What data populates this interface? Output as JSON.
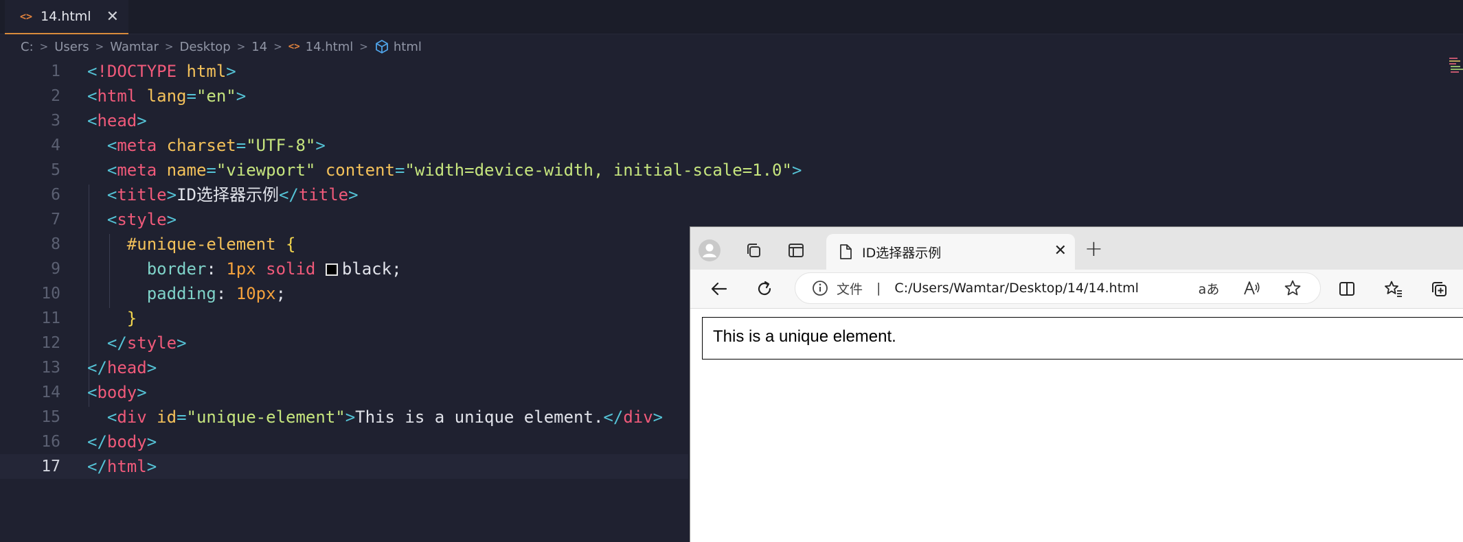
{
  "editor": {
    "tab": {
      "icon": "code-file-icon",
      "icon_glyph": "<>",
      "name": "14.html",
      "close": "✕"
    },
    "breadcrumb": [
      "C:",
      "Users",
      "Wamtar",
      "Desktop",
      "14",
      "14.html",
      "html"
    ],
    "breadcrumb_sep": ">",
    "current_line": 17,
    "lines": [
      {
        "n": "1",
        "parts": [
          [
            "t-punct",
            "<"
          ],
          [
            "t-tag",
            "!DOCTYPE"
          ],
          [
            "t-plain",
            " "
          ],
          [
            "t-attr",
            "html"
          ],
          [
            "t-punct",
            ">"
          ]
        ]
      },
      {
        "n": "2",
        "parts": [
          [
            "t-punct",
            "<"
          ],
          [
            "t-tag",
            "html"
          ],
          [
            "t-plain",
            " "
          ],
          [
            "t-attr",
            "lang"
          ],
          [
            "t-punct",
            "="
          ],
          [
            "t-str",
            "\"en\""
          ],
          [
            "t-punct",
            ">"
          ]
        ]
      },
      {
        "n": "3",
        "parts": [
          [
            "t-punct",
            "<"
          ],
          [
            "t-tag",
            "head"
          ],
          [
            "t-punct",
            ">"
          ]
        ]
      },
      {
        "n": "4",
        "parts": [
          [
            "t-plain",
            "  "
          ],
          [
            "t-punct",
            "<"
          ],
          [
            "t-tag",
            "meta"
          ],
          [
            "t-plain",
            " "
          ],
          [
            "t-attr",
            "charset"
          ],
          [
            "t-punct",
            "="
          ],
          [
            "t-str",
            "\"UTF-8\""
          ],
          [
            "t-punct",
            ">"
          ]
        ]
      },
      {
        "n": "5",
        "parts": [
          [
            "t-plain",
            "  "
          ],
          [
            "t-punct",
            "<"
          ],
          [
            "t-tag",
            "meta"
          ],
          [
            "t-plain",
            " "
          ],
          [
            "t-attr",
            "name"
          ],
          [
            "t-punct",
            "="
          ],
          [
            "t-str",
            "\"viewport\""
          ],
          [
            "t-plain",
            " "
          ],
          [
            "t-attr",
            "content"
          ],
          [
            "t-punct",
            "="
          ],
          [
            "t-str",
            "\"width=device-width, initial-scale=1.0\""
          ],
          [
            "t-punct",
            ">"
          ]
        ]
      },
      {
        "n": "6",
        "parts": [
          [
            "t-plain",
            "  "
          ],
          [
            "t-punct",
            "<"
          ],
          [
            "t-tag",
            "title"
          ],
          [
            "t-punct",
            ">"
          ],
          [
            "t-plain",
            "ID选择器示例"
          ],
          [
            "t-punct",
            "</"
          ],
          [
            "t-tag",
            "title"
          ],
          [
            "t-punct",
            ">"
          ]
        ]
      },
      {
        "n": "7",
        "parts": [
          [
            "t-plain",
            "  "
          ],
          [
            "t-punct",
            "<"
          ],
          [
            "t-tag",
            "style"
          ],
          [
            "t-punct",
            ">"
          ]
        ]
      },
      {
        "n": "8",
        "parts": [
          [
            "t-plain",
            "    "
          ],
          [
            "t-sel",
            "#unique-element"
          ],
          [
            "t-plain",
            " "
          ],
          [
            "t-brace",
            "{"
          ]
        ]
      },
      {
        "n": "9",
        "parts": [
          [
            "t-plain",
            "      "
          ],
          [
            "t-prop",
            "border"
          ],
          [
            "t-plain",
            ": "
          ],
          [
            "t-num",
            "1px"
          ],
          [
            "t-plain",
            " "
          ],
          [
            "t-kw",
            "solid"
          ],
          [
            "t-plain",
            " "
          ],
          [
            "swatch",
            ""
          ],
          [
            "t-plain",
            "black;"
          ]
        ]
      },
      {
        "n": "10",
        "parts": [
          [
            "t-plain",
            "      "
          ],
          [
            "t-prop",
            "padding"
          ],
          [
            "t-plain",
            ": "
          ],
          [
            "t-num",
            "10px"
          ],
          [
            "t-plain",
            ";"
          ]
        ]
      },
      {
        "n": "11",
        "parts": [
          [
            "t-plain",
            "    "
          ],
          [
            "t-brace",
            "}"
          ]
        ]
      },
      {
        "n": "12",
        "parts": [
          [
            "t-plain",
            "  "
          ],
          [
            "t-punct",
            "</"
          ],
          [
            "t-tag",
            "style"
          ],
          [
            "t-punct",
            ">"
          ]
        ]
      },
      {
        "n": "13",
        "parts": [
          [
            "t-punct",
            "</"
          ],
          [
            "t-tag",
            "head"
          ],
          [
            "t-punct",
            ">"
          ]
        ]
      },
      {
        "n": "14",
        "parts": [
          [
            "t-punct",
            "<"
          ],
          [
            "t-tag",
            "body"
          ],
          [
            "t-punct",
            ">"
          ]
        ]
      },
      {
        "n": "15",
        "parts": [
          [
            "t-plain",
            "  "
          ],
          [
            "t-punct",
            "<"
          ],
          [
            "t-tag",
            "div"
          ],
          [
            "t-plain",
            " "
          ],
          [
            "t-attr",
            "id"
          ],
          [
            "t-punct",
            "="
          ],
          [
            "t-str",
            "\"unique-element\""
          ],
          [
            "t-punct",
            ">"
          ],
          [
            "t-plain",
            "This is a unique element."
          ],
          [
            "t-punct",
            "</"
          ],
          [
            "t-tag",
            "div"
          ],
          [
            "t-punct",
            ">"
          ]
        ]
      },
      {
        "n": "16",
        "parts": [
          [
            "t-punct",
            "</"
          ],
          [
            "t-tag",
            "body"
          ],
          [
            "t-punct",
            ">"
          ]
        ]
      },
      {
        "n": "17",
        "parts": [
          [
            "t-punct",
            "</"
          ],
          [
            "t-tag",
            "html"
          ],
          [
            "t-punct",
            ">"
          ]
        ]
      }
    ]
  },
  "browser": {
    "tab_title": "ID选择器示例",
    "tab_close": "✕",
    "new_tab": "+",
    "address": {
      "scheme_label": "文件",
      "separator": "|",
      "url": "C:/Users/Wamtar/Desktop/14/14.html"
    },
    "read_aloud_label": "aあ",
    "page_text": "This is a unique element."
  }
}
